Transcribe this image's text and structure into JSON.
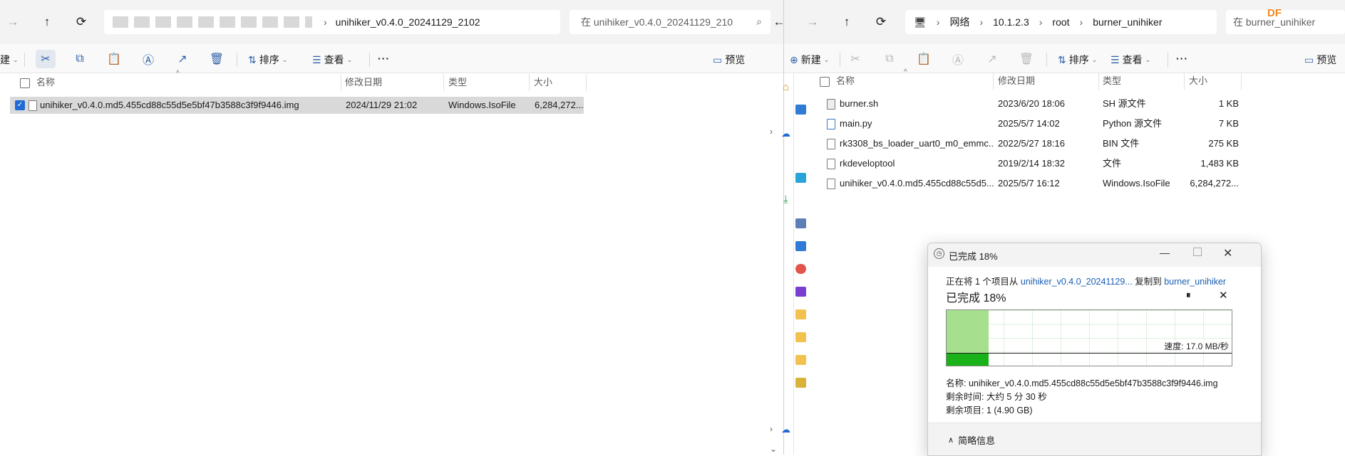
{
  "left": {
    "address": "unihiker_v0.4.0_20241129_2102",
    "search_placeholder": "在 unihiker_v0.4.0_20241129_210",
    "toolbar": {
      "new_partial": "建",
      "sort": "排序",
      "view": "查看",
      "more": "···",
      "preview": "预览"
    },
    "columns": {
      "name": "名称",
      "date": "修改日期",
      "type": "类型",
      "size": "大小"
    },
    "files": [
      {
        "name": "unihiker_v0.4.0.md5.455cd88c55d5e5bf47b3588c3f9f9446.img",
        "date": "2024/11/29 21:02",
        "type": "Windows.IsoFile",
        "size": "6,284,272..."
      }
    ]
  },
  "right": {
    "breadcrumbs": [
      "网络",
      "10.1.2.3",
      "root",
      "burner_unihiker"
    ],
    "search_placeholder": "在 burner_unihiker",
    "watermark": "DF",
    "toolbar": {
      "new": "新建",
      "sort": "排序",
      "view": "查看",
      "more": "···",
      "preview": "预览"
    },
    "columns": {
      "name": "名称",
      "date": "修改日期",
      "type": "类型",
      "size": "大小"
    },
    "files": [
      {
        "name": "burner.sh",
        "date": "2023/6/20 18:06",
        "type": "SH 源文件",
        "size": "1 KB"
      },
      {
        "name": "main.py",
        "date": "2025/5/7 14:02",
        "type": "Python 源文件",
        "size": "7 KB"
      },
      {
        "name": "rk3308_bs_loader_uart0_m0_emmc...",
        "date": "2022/5/27 18:16",
        "type": "BIN 文件",
        "size": "275 KB"
      },
      {
        "name": "rkdeveloptool",
        "date": "2019/2/14 18:32",
        "type": "文件",
        "size": "1,483 KB"
      },
      {
        "name": "unihiker_v0.4.0.md5.455cd88c55d5...",
        "date": "2025/5/7 16:12",
        "type": "Windows.IsoFile",
        "size": "6,284,272..."
      }
    ]
  },
  "dialog": {
    "title": "已完成 18%",
    "copy_prefix": "正在将 1 个项目从",
    "source": "unihiker_v0.4.0_20241129...",
    "copy_middle": "复制到",
    "destination": "burner_unihiker",
    "heading": "已完成 18%",
    "progress_percent": 18,
    "speed": "速度: 17.0 MB/秒",
    "name_line": "名称: unihiker_v0.4.0.md5.455cd88c55d5e5bf47b3588c3f9f9446.img",
    "time_line": "剩余时间: 大约 5 分 30 秒",
    "items_line": "剩余项目: 1 (4.90 GB)",
    "less_details": "简略信息"
  },
  "colors": {
    "accent": "#1a5fb4",
    "progress_fill": "#a6e08f",
    "progress_bar": "#19b219"
  }
}
